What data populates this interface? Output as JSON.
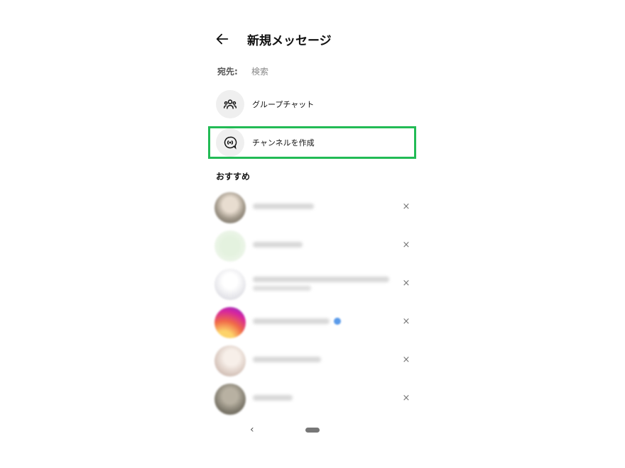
{
  "header": {
    "title": "新規メッセージ",
    "back_icon": "arrow-left-icon"
  },
  "to": {
    "label": "宛先:",
    "placeholder": "検索"
  },
  "actions": [
    {
      "label": "グループチャット",
      "icon": "group-icon"
    },
    {
      "label": "チャンネルを作成",
      "icon": "channel-icon"
    }
  ],
  "suggested": {
    "title": "おすすめ",
    "contacts": [
      {
        "avatar_color": "#b9b2a4",
        "close": "×"
      },
      {
        "avatar_color": "#cfe8c9",
        "close": "×"
      },
      {
        "avatar_color": "#e9e9ee",
        "close": "×"
      },
      {
        "avatar_color": "#f0567a",
        "close": "×",
        "verified": true
      },
      {
        "avatar_color": "#e2d2cc",
        "close": "×"
      },
      {
        "avatar_color": "#8f8b7e",
        "close": "×"
      }
    ]
  },
  "colors": {
    "highlight": "#22bb55"
  }
}
